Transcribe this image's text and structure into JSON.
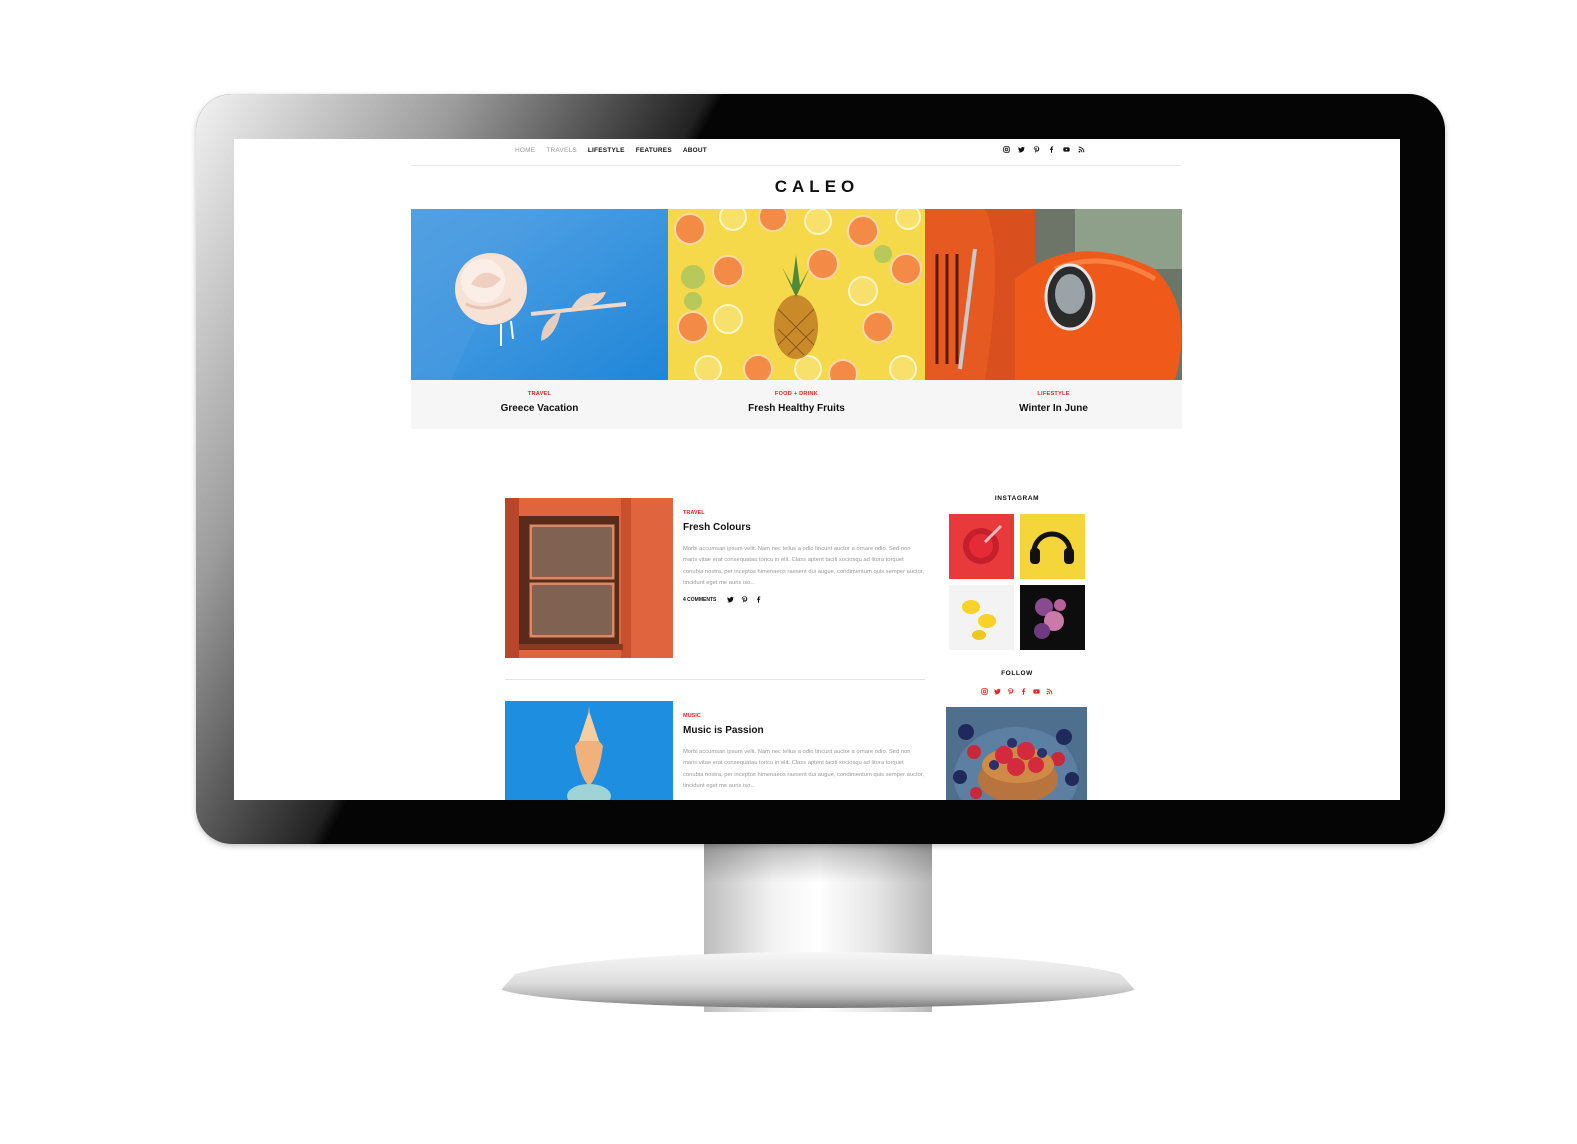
{
  "colors": {
    "accent": "#e52420",
    "text": "#111111",
    "muted": "#999999",
    "monitor_bezel": "#050505"
  },
  "nav": {
    "items": [
      {
        "label": "HOME",
        "dim": true
      },
      {
        "label": "TRAVELS",
        "dim": true
      },
      {
        "label": "LIFESTYLE",
        "dim": false
      },
      {
        "label": "FEATURES",
        "dim": false
      },
      {
        "label": "ABOUT",
        "dim": false
      }
    ],
    "social_icons": [
      "instagram-icon",
      "twitter-icon",
      "pinterest-icon",
      "facebook-icon",
      "youtube-icon",
      "rss-icon"
    ]
  },
  "site": {
    "logo": "CALEO"
  },
  "featured": [
    {
      "category": "TRAVEL",
      "title": "Greece Vacation",
      "image": "pink-rose-on-blue"
    },
    {
      "category": "FOOD + DRINK",
      "title": "Fresh Healthy Fruits",
      "image": "pineapple-and-citrus-slices"
    },
    {
      "category": "LIFESTYLE",
      "title": "Winter In June",
      "image": "orange-vintage-car"
    }
  ],
  "posts": [
    {
      "category": "TRAVEL",
      "title": "Fresh Colours",
      "excerpt": "Morbi accumsan ipsum velit. Nam nec tellus a odio tincunt auctor a ornare odio. Sed non maris vitae erat consequatau toricu in elit. Class aptent taciti sociosqu ad litora torquet conubia nostra, per inceptos himenaeos raesent dui augue, condimentum quis semper auctor, tincidunt eget me auris iso...",
      "comments": "4 COMMENTS",
      "share_icons": [
        "twitter-icon",
        "pinterest-icon",
        "facebook-icon"
      ],
      "image": "window-on-orange-wall"
    },
    {
      "category": "MUSIC",
      "title": "Music is Passion",
      "excerpt": "Morbi accumsan ipsum velit. Nam nec tellus a odio tincunt auctor a ornare odio. Sed non maris vitae erat consequatau toricu in elit. Class aptent taciti sociosqu ad litora torquet conubia nostra, per inceptos himenaeos raesent dui augue, condimentum quis semper auctor, tincidunt eget me auris iso...",
      "image": "pineapple-on-blue"
    }
  ],
  "sidebar": {
    "instagram_title": "INSTAGRAM",
    "instagram_images": [
      "red-bowl",
      "yellow-headphones",
      "lemons",
      "purple-flowers"
    ],
    "follow_title": "FOLLOW",
    "follow_icons": [
      "instagram-icon",
      "twitter-icon",
      "pinterest-icon",
      "facebook-icon",
      "youtube-icon",
      "rss-icon"
    ],
    "banner_image": "berry-pancakes"
  }
}
